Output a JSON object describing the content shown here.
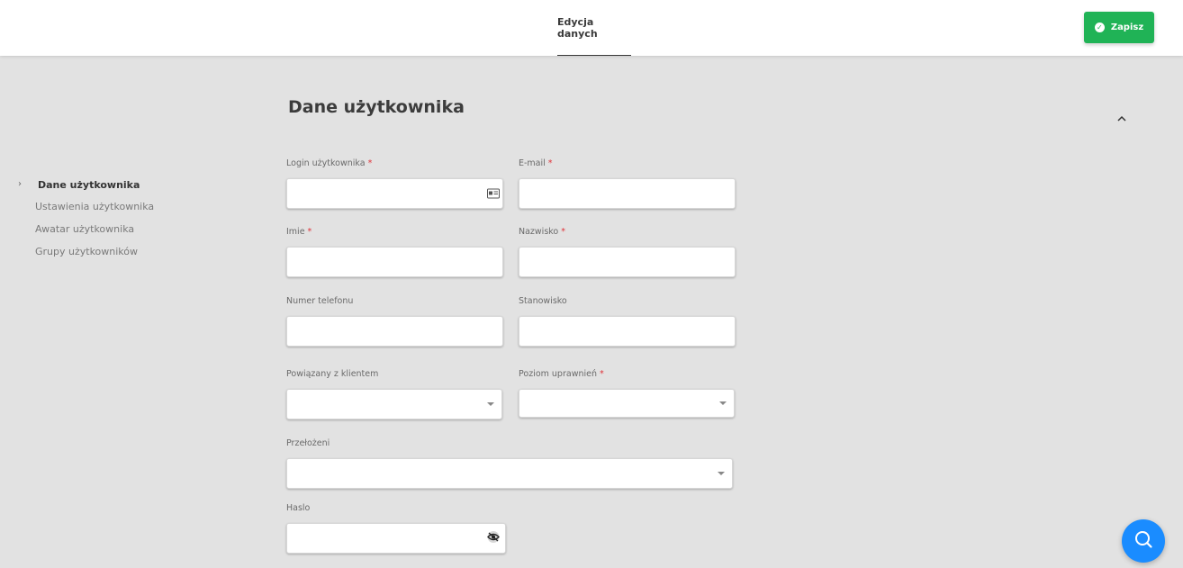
{
  "header": {
    "tab_label": "Edycja danych",
    "save_label": "Zapisz",
    "save_color": "#20b356"
  },
  "sidebar": {
    "items": [
      {
        "label": "Dane użytkownika",
        "active": true
      },
      {
        "label": "Ustawienia użytkownika",
        "active": false
      },
      {
        "label": "Awatar użytkownika",
        "active": false
      },
      {
        "label": "Grupy użytkowników",
        "active": false
      }
    ]
  },
  "section": {
    "title": "Dane użytkownika"
  },
  "form": {
    "login": {
      "label": "Login użytkownika",
      "required": "*",
      "value": ""
    },
    "email": {
      "label": "E-mail",
      "required": "*",
      "value": ""
    },
    "first_name": {
      "label": "Imie",
      "required": "*",
      "value": ""
    },
    "last_name": {
      "label": "Nazwisko",
      "required": "*",
      "value": ""
    },
    "phone": {
      "label": "Numer telefonu",
      "value": ""
    },
    "position": {
      "label": "Stanowisko",
      "value": ""
    },
    "client": {
      "label": "Powiązany z klientem",
      "value": ""
    },
    "permission": {
      "label": "Poziom uprawnień",
      "required": "*",
      "value": ""
    },
    "superiors": {
      "label": "Przełożeni",
      "value": ""
    },
    "password": {
      "label": "Haslo",
      "value": ""
    }
  },
  "icons": {
    "save": "check-circle-icon",
    "collapse": "chevron-up-icon",
    "login_field": "id-card-icon",
    "password_field": "eye-slash-icon",
    "fab": "search-icon"
  },
  "colors": {
    "accent": "#1a8cff",
    "required": "#e0333a",
    "background": "#e2e2e2"
  }
}
